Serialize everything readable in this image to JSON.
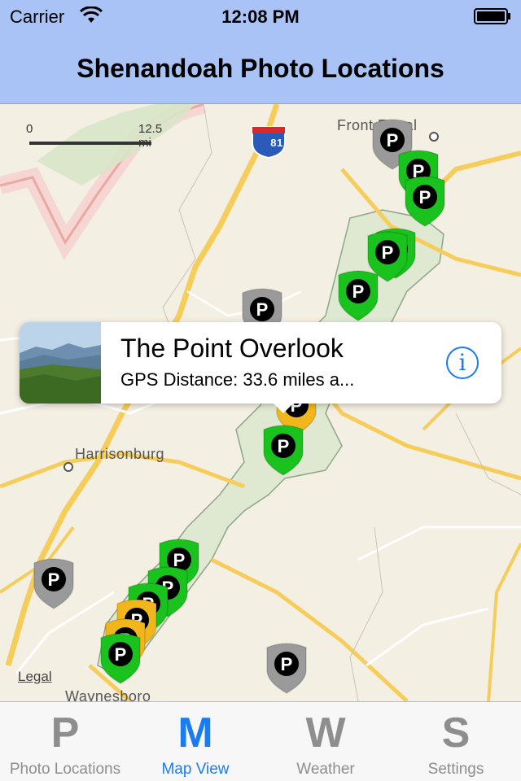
{
  "status": {
    "carrier": "Carrier",
    "time": "12:08 PM"
  },
  "nav": {
    "title": "Shenandoah Photo Locations"
  },
  "map": {
    "scale_start": "0",
    "scale_end": "12.5 mi",
    "cities": [
      "Front Royal",
      "Harrisonburg",
      "Waynesboro"
    ],
    "shield": "81",
    "legal": "Legal",
    "pin_letter": "P"
  },
  "callout": {
    "title": "The Point Overlook",
    "subtitle": "GPS Distance:  33.6 miles a...",
    "info_glyph": "i"
  },
  "tabs": [
    {
      "glyph": "P",
      "label": "Photo Locations"
    },
    {
      "glyph": "M",
      "label": "Map View"
    },
    {
      "glyph": "W",
      "label": "Weather"
    },
    {
      "glyph": "S",
      "label": "Settings"
    }
  ],
  "colors": {
    "bar": "#a9c3f6",
    "accent": "#1a7cf2",
    "pin_green": "#19c21c",
    "pin_gray": "#9a9a9a",
    "pin_yellow": "#f2b61d",
    "park": "#dfe9d2",
    "road": "#f6cd5a"
  }
}
